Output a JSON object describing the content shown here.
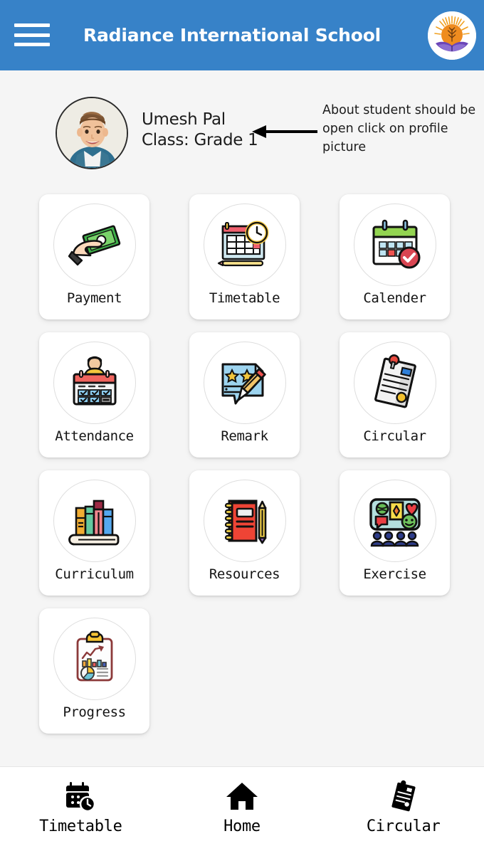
{
  "header": {
    "title": "Radiance International School",
    "menu_icon": "hamburger-menu-icon",
    "logo_icon": "school-logo-sun-tree-book",
    "background_color": "#3782C8"
  },
  "profile": {
    "avatar_icon": "student-profile-photo",
    "name": "Umesh Pal",
    "class": "Class: Grade 1"
  },
  "annotation": {
    "text": "About student should be open click on profile picture",
    "arrow_icon": "left-arrow-annotation"
  },
  "grid": {
    "tiles": [
      {
        "label": "Payment",
        "icon": "hand-holding-money-icon"
      },
      {
        "label": "Timetable",
        "icon": "timetable-grid-clock-icon"
      },
      {
        "label": "Calender",
        "icon": "calendar-check-icon"
      },
      {
        "label": "Attendance",
        "icon": "attendance-checklist-person-icon"
      },
      {
        "label": "Remark",
        "icon": "remark-note-pencil-stars-icon"
      },
      {
        "label": "Circular",
        "icon": "pinned-document-icon"
      },
      {
        "label": "Curriculum",
        "icon": "stacked-books-icon"
      },
      {
        "label": "Resources",
        "icon": "red-notebook-pencil-icon"
      },
      {
        "label": "Exercise",
        "icon": "activity-board-people-icon"
      },
      {
        "label": "Progress",
        "icon": "clipboard-chart-icon"
      }
    ]
  },
  "bottom_nav": {
    "items": [
      {
        "label": "Timetable",
        "icon": "calendar-clock-icon"
      },
      {
        "label": "Home",
        "icon": "home-house-icon"
      },
      {
        "label": "Circular",
        "icon": "pinned-document-icon"
      }
    ]
  },
  "colors": {
    "page_background": "#F5F5F5",
    "card_background": "#FFFFFF",
    "text_primary": "#1C1C1C"
  }
}
